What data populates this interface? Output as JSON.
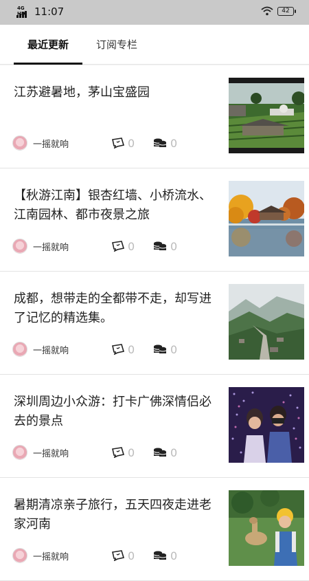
{
  "status_bar": {
    "network": "4G HD",
    "time": "11:07",
    "battery": "42"
  },
  "tabs": [
    {
      "label": "最近更新",
      "active": true
    },
    {
      "label": "订阅专栏",
      "active": false
    }
  ],
  "articles": [
    {
      "title": "江苏避暑地，茅山宝盛园",
      "author": "一摇就响",
      "comments": "0",
      "coins": "0",
      "image": "garden-pavilion-photo"
    },
    {
      "title": "【秋游江南】银杏红墙、小桥流水、江南园林、都市夜景之旅",
      "author": "一摇就响",
      "comments": "0",
      "coins": "0",
      "image": "autumn-lake-photo"
    },
    {
      "title": "成都，想带走的全都带不走，却写进了记忆的精选集。",
      "author": "一摇就响",
      "comments": "0",
      "coins": "0",
      "image": "mountain-valley-photo"
    },
    {
      "title": "深圳周边小众游：打卡广佛深情侣必去的景点",
      "author": "一摇就响",
      "comments": "0",
      "coins": "0",
      "image": "couple-lights-photo"
    },
    {
      "title": "暑期清凉亲子旅行，五天四夜走进老家河南",
      "author": "一摇就响",
      "comments": "0",
      "coins": "0",
      "image": "child-alpaca-photo"
    }
  ]
}
